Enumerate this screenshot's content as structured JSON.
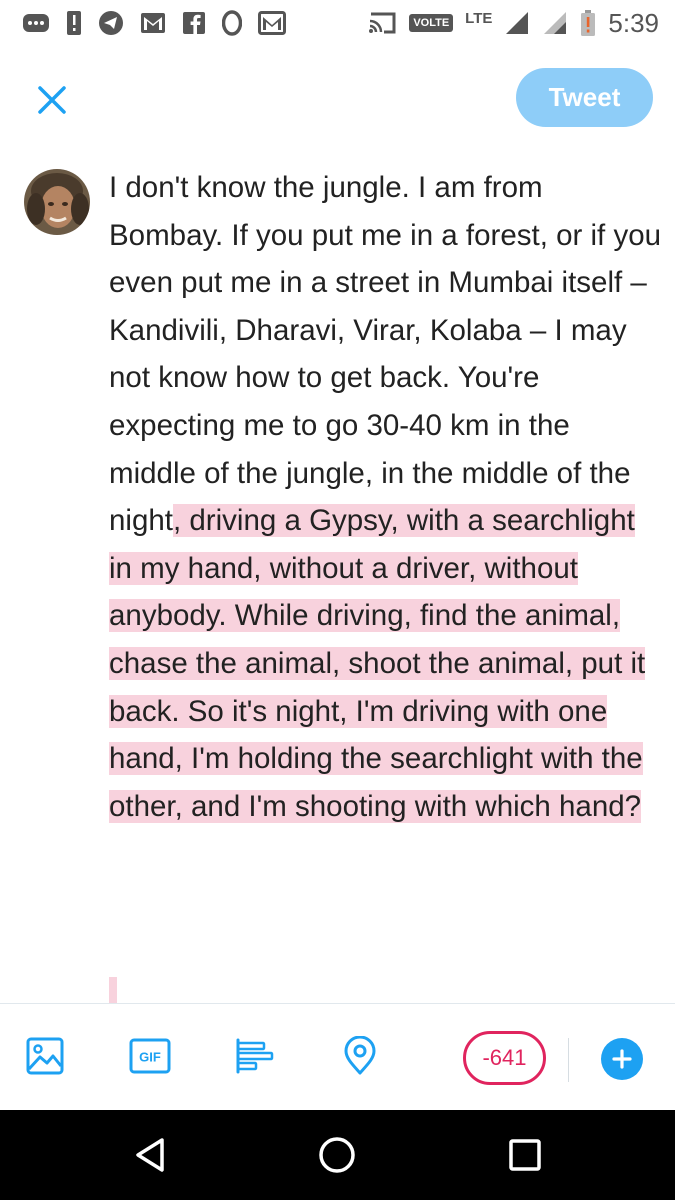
{
  "status_bar": {
    "volte_label": "VOLTE",
    "network_label": "LTE",
    "time": "5:39",
    "icons": [
      "more-dots-icon",
      "alert-icon",
      "telegram-icon",
      "gmail-icon",
      "facebook-icon",
      "opera-icon",
      "mail-icon",
      "cast-icon",
      "signal-icon",
      "signal-icon",
      "battery-alert-icon"
    ]
  },
  "header": {
    "close_icon": "close-icon",
    "tweet_label": "Tweet"
  },
  "compose": {
    "text_plain": "I don't know the jungle. I am from Bombay. If you put me in a forest, or if you even put me in a street in Mumbai itself – Kandivili, Dharavi, Virar, Kolaba – I may not know how to get back. You're expecting me to go 30-40 km in the middle of the jungle, in the middle of the night",
    "text_overflow": ", driving a Gypsy, with a searchlight in my hand, without a driver, without anybody. While driving, find the animal, chase the animal, shoot the animal, put it back. So it's night, I'm driving with one hand, I'm holding the searchlight with the other, and I'm shooting with which hand?"
  },
  "toolbar": {
    "icons": [
      "image-icon",
      "gif-icon",
      "poll-icon",
      "location-icon"
    ],
    "gif_label": "GIF",
    "char_counter": "-641",
    "add_icon": "add-icon"
  },
  "nav_bar": {
    "icons": [
      "back-icon",
      "home-icon",
      "recents-icon"
    ]
  },
  "colors": {
    "accent": "#1da1f2",
    "tweet_button_disabled": "#8ecdf8",
    "overflow_highlight": "#f8d2dd",
    "counter_red": "#e0245e"
  }
}
